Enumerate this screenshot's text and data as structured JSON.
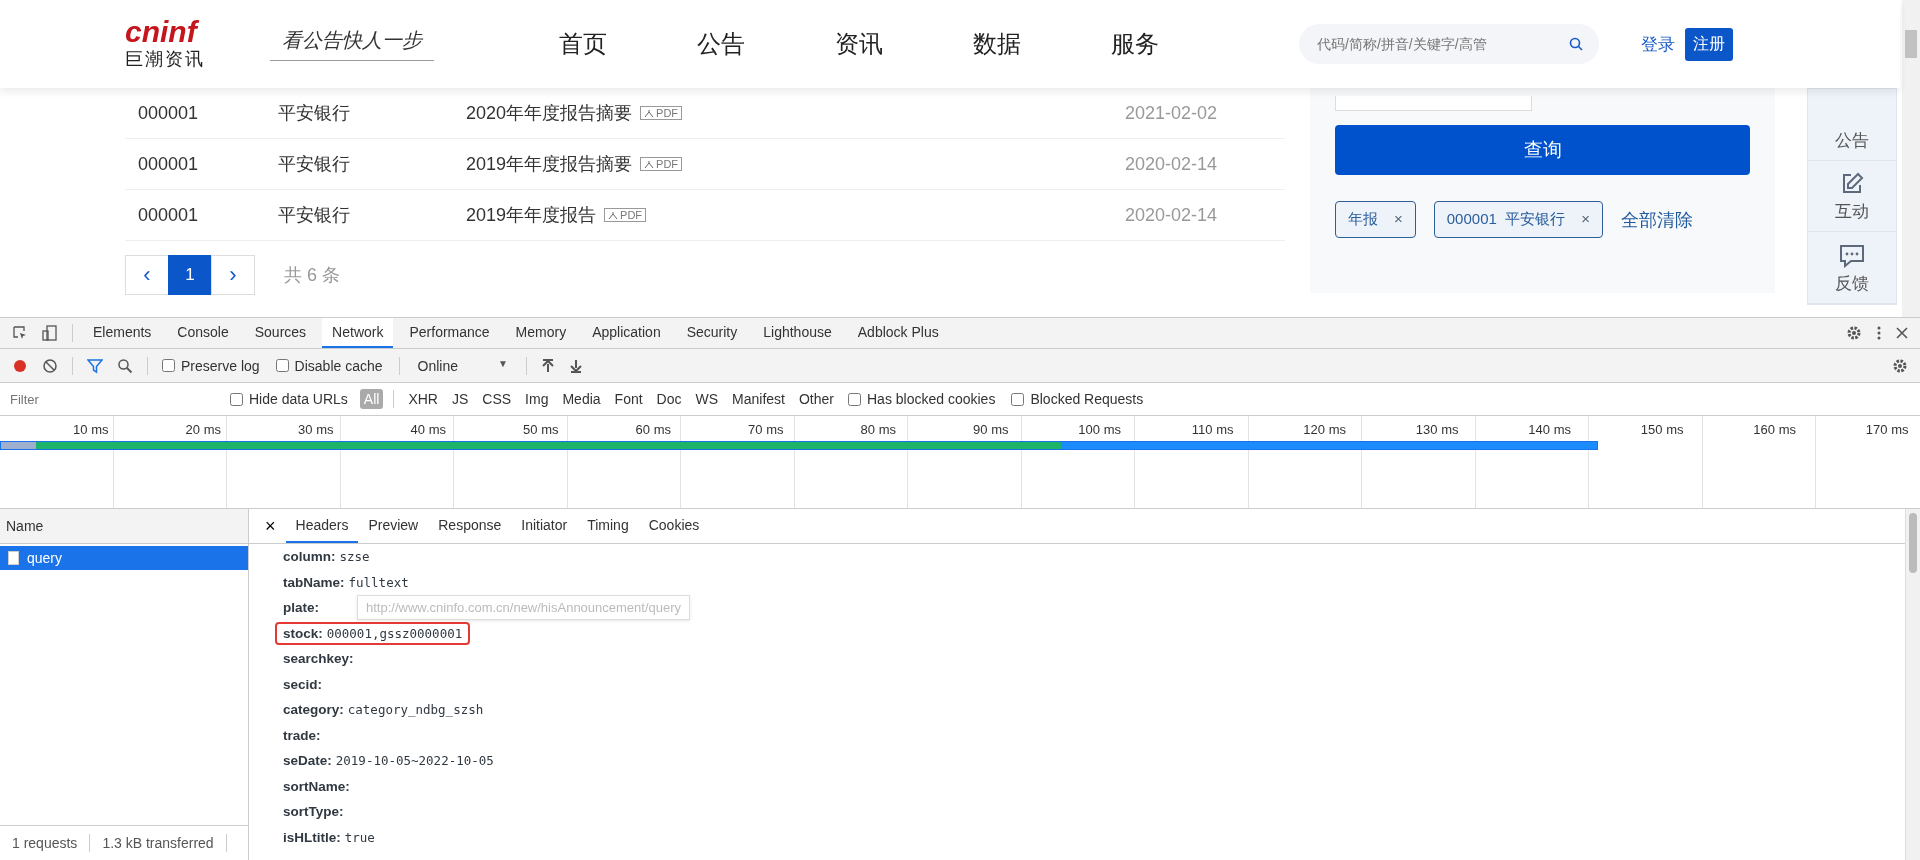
{
  "site": {
    "logo_text": "cninf",
    "logo_subtitle": "巨潮资讯",
    "slogan": "看公告快人一步",
    "nav": [
      {
        "label": "首页"
      },
      {
        "label": "公告"
      },
      {
        "label": "资讯"
      },
      {
        "label": "数据"
      },
      {
        "label": "服务"
      }
    ],
    "search": {
      "placeholder": "代码/简称/拼音/关键字/高管"
    },
    "login": "登录",
    "register": "注册",
    "rows": [
      {
        "code": "000001",
        "name": "平安银行",
        "title": "2020年年度报告摘要",
        "file": "PDF",
        "date": "2021-02-02"
      },
      {
        "code": "000001",
        "name": "平安银行",
        "title": "2019年年度报告摘要",
        "file": "PDF",
        "date": "2020-02-14"
      },
      {
        "code": "000001",
        "name": "平安银行",
        "title": "2019年年度报告",
        "file": "PDF",
        "date": "2020-02-14"
      }
    ],
    "pagination": {
      "prev": "‹",
      "pages": [
        {
          "label": "1",
          "selected": true
        }
      ],
      "next": "›",
      "total": "共 6 条"
    },
    "query_button": "查询",
    "tags": [
      {
        "label": "年报",
        "close": "×"
      },
      {
        "label": "000001  平安银行",
        "close": "×"
      }
    ],
    "clear_all": "全部清除",
    "side_tools": [
      {
        "kind": "announce",
        "label": "公告"
      },
      {
        "kind": "edit",
        "label": "互动"
      },
      {
        "kind": "chat",
        "label": "反馈"
      }
    ]
  },
  "devtools": {
    "tabs": [
      {
        "label": "Elements",
        "selected": false
      },
      {
        "label": "Console",
        "selected": false
      },
      {
        "label": "Sources",
        "selected": false
      },
      {
        "label": "Network",
        "selected": true
      },
      {
        "label": "Performance",
        "selected": false
      },
      {
        "label": "Memory",
        "selected": false
      },
      {
        "label": "Application",
        "selected": false
      },
      {
        "label": "Security",
        "selected": false
      },
      {
        "label": "Lighthouse",
        "selected": false
      },
      {
        "label": "Adblock Plus",
        "selected": false
      }
    ],
    "toolbar": {
      "preserve_log": {
        "label": "Preserve log",
        "checked": false
      },
      "disable_cache": {
        "label": "Disable cache",
        "checked": false
      },
      "throttle": "Online",
      "throttle_caret": "▼"
    },
    "filter": {
      "placeholder": "Filter",
      "hide_data_urls": {
        "label": "Hide data URLs",
        "checked": false
      },
      "types": [
        {
          "label": "All",
          "selected": true
        },
        {
          "label": "XHR",
          "selected": false
        },
        {
          "label": "JS",
          "selected": false
        },
        {
          "label": "CSS",
          "selected": false
        },
        {
          "label": "Img",
          "selected": false
        },
        {
          "label": "Media",
          "selected": false
        },
        {
          "label": "Font",
          "selected": false
        },
        {
          "label": "Doc",
          "selected": false
        },
        {
          "label": "WS",
          "selected": false
        },
        {
          "label": "Manifest",
          "selected": false
        },
        {
          "label": "Other",
          "selected": false
        }
      ],
      "has_blocked_cookies": {
        "label": "Has blocked cookies",
        "checked": false
      },
      "blocked_requests": {
        "label": "Blocked Requests",
        "checked": false
      }
    },
    "timeline_ticks": [
      "10 ms",
      "20 ms",
      "30 ms",
      "40 ms",
      "50 ms",
      "60 ms",
      "70 ms",
      "80 ms",
      "90 ms",
      "100 ms",
      "110 ms",
      "120 ms",
      "130 ms",
      "140 ms",
      "150 ms",
      "160 ms",
      "170 ms"
    ],
    "name_header": "Name",
    "requests": [
      {
        "name": "query",
        "selected": true
      }
    ],
    "status": {
      "requests": "1 requests",
      "transferred": "1.3 kB transferred"
    },
    "detail_close": "×",
    "detail_tabs": [
      {
        "label": "Headers",
        "selected": true
      },
      {
        "label": "Preview",
        "selected": false
      },
      {
        "label": "Response",
        "selected": false
      },
      {
        "label": "Initiator",
        "selected": false
      },
      {
        "label": "Timing",
        "selected": false
      },
      {
        "label": "Cookies",
        "selected": false
      }
    ],
    "tooltip": "http://www.cninfo.com.cn/new/hisAnnouncement/query",
    "params": [
      {
        "key": "column:",
        "value": "szse",
        "highlighted": false
      },
      {
        "key": "tabName:",
        "value": "fulltext",
        "highlighted": false
      },
      {
        "key": "plate:",
        "highlighted": false
      },
      {
        "key": "stock:",
        "value": "000001,gssz0000001",
        "highlighted": true
      },
      {
        "key": "searchkey:",
        "highlighted": false
      },
      {
        "key": "secid:",
        "highlighted": false
      },
      {
        "key": "category:",
        "value": "category_ndbg_szsh",
        "highlighted": false
      },
      {
        "key": "trade:",
        "highlighted": false
      },
      {
        "key": "seDate:",
        "value": "2019-10-05~2022-10-05",
        "highlighted": false
      },
      {
        "key": "sortName:",
        "highlighted": false
      },
      {
        "key": "sortType:",
        "highlighted": false
      },
      {
        "key": "isHLtitle:",
        "value": "true",
        "highlighted": false
      }
    ]
  }
}
